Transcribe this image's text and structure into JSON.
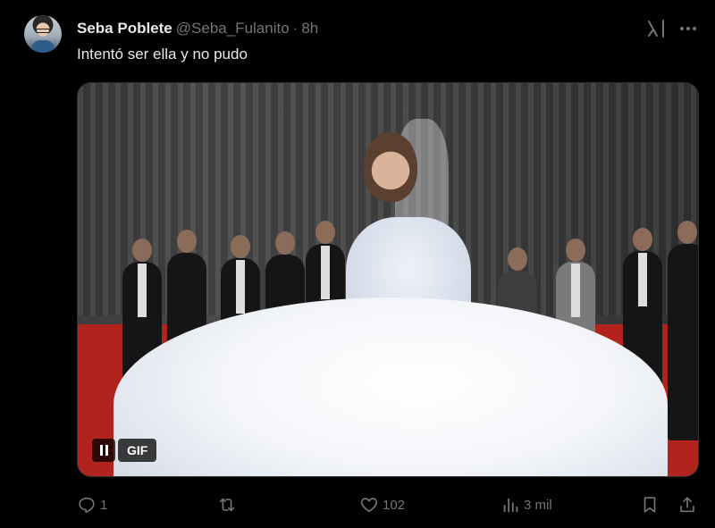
{
  "tweet": {
    "author_name": "Seba Poblete",
    "handle": "@Seba_Fulanito",
    "separator": "·",
    "time": "8h",
    "text": "Intentó ser ella y no pudo"
  },
  "media": {
    "type": "gif",
    "badge_label": "GIF",
    "paused": false
  },
  "actions": {
    "replies": "1",
    "retweets": "",
    "likes": "102",
    "views": "3 mil"
  },
  "icons": {
    "grok": "grok-icon",
    "more": "more-icon",
    "reply": "reply-icon",
    "retweet": "retweet-icon",
    "like": "heart-icon",
    "views": "views-icon",
    "bookmark": "bookmark-icon",
    "share": "share-icon",
    "pause": "pause-icon"
  },
  "colors": {
    "background": "#000000",
    "text_primary": "#e7e9ea",
    "text_secondary": "#71767b",
    "border": "#2f3336"
  }
}
